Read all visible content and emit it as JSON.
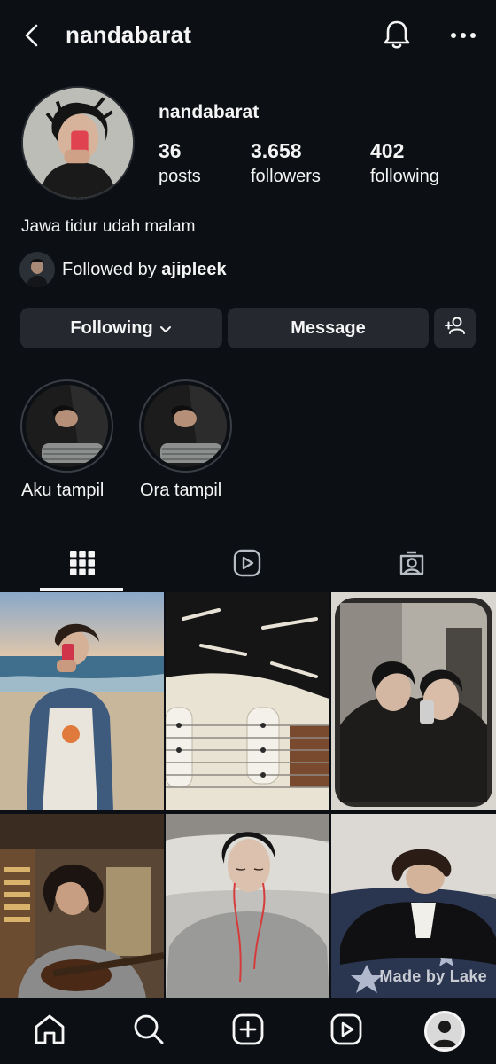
{
  "header": {
    "title": "nandabarat",
    "back_icon": "chevron-left-icon",
    "notification_icon": "bell-icon",
    "more_icon": "more-horizontal-icon"
  },
  "profile": {
    "username": "nandabarat",
    "stats": [
      {
        "value": "36",
        "label": "posts"
      },
      {
        "value": "3.658",
        "label": "followers"
      },
      {
        "value": "402",
        "label": "following"
      }
    ],
    "bio": "Jawa tidur udah malam",
    "followed_by_prefix": "Followed by ",
    "followed_by_user": "ajipleek"
  },
  "actions": {
    "following_label": "Following",
    "message_label": "Message",
    "add_user_icon": "add-user-icon"
  },
  "highlights": [
    {
      "label": "Aku tampil"
    },
    {
      "label": "Ora tampil"
    }
  ],
  "tabs": [
    {
      "icon": "grid-icon",
      "active": true
    },
    {
      "icon": "reels-icon",
      "active": false
    },
    {
      "icon": "tagged-icon",
      "active": false
    }
  ],
  "grid": {
    "watermark": "Made by Lake"
  },
  "bottom_nav": [
    {
      "icon": "home-icon"
    },
    {
      "icon": "search-icon"
    },
    {
      "icon": "create-icon"
    },
    {
      "icon": "reels-icon"
    },
    {
      "icon": "profile-avatar-icon"
    }
  ],
  "colors": {
    "background": "#0c0f14",
    "button_bg": "#25282e",
    "text": "#f5f5f5"
  }
}
